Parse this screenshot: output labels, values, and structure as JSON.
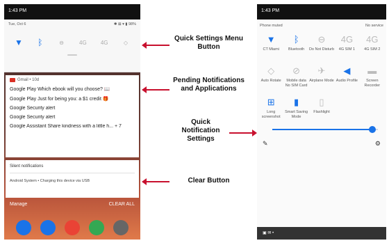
{
  "left": {
    "status_time": "1:43 PM",
    "qs": {
      "date": "Tue, Oct 6",
      "status_icons": "✱ ⊠ ▾ ▮ 98%"
    },
    "notification": {
      "app": "Gmail • 10d",
      "lines": [
        "Google Play Which ebook will you choose? 📖",
        "Google Play Just for being you: a $1 credit 🎁",
        "Google Security alert",
        "Google Security alert",
        "Google Assistant Share kindness with a little h... + 7"
      ]
    },
    "silent": {
      "title": "Silent notifications",
      "item": "Android System • Charging this device via USB"
    },
    "bottom": {
      "manage": "Manage",
      "clear_all": "CLEAR ALL"
    }
  },
  "annotations": {
    "qs_button": "Quick Settings Menu Button",
    "pending": "Pending Notifications and Applications",
    "quick_settings": "Quick Notification Settings",
    "clear": "Clear Button"
  },
  "right": {
    "status_time": "1:43 PM",
    "phone_status": "Phone muted",
    "service": "No service",
    "tiles": [
      {
        "label": "CT Miami",
        "icon": "wifi",
        "on": true
      },
      {
        "label": "Bluetooth",
        "icon": "bluetooth",
        "on": true
      },
      {
        "label": "Do Not Disturb",
        "icon": "dnd",
        "on": false
      },
      {
        "label": "4G SIM 1",
        "icon": "4g",
        "on": false
      },
      {
        "label": "4G SIM 2",
        "icon": "4g",
        "on": false
      },
      {
        "label": "Auto Rotate",
        "icon": "rotate",
        "on": false
      },
      {
        "label": "Mobile data No SIM Card",
        "icon": "mobile-data",
        "on": false
      },
      {
        "label": "Airplane Mode",
        "icon": "airplane",
        "on": false
      },
      {
        "label": "Audio Profile",
        "icon": "audio",
        "on": true
      },
      {
        "label": "Screen Recorder",
        "icon": "recorder",
        "on": false
      },
      {
        "label": "Long screenshot",
        "icon": "screenshot",
        "on": true
      },
      {
        "label": "Smart Saving Mode",
        "icon": "battery",
        "on": true
      },
      {
        "label": "Flashlight",
        "icon": "flashlight",
        "on": false
      }
    ],
    "brightness": 0.95
  }
}
